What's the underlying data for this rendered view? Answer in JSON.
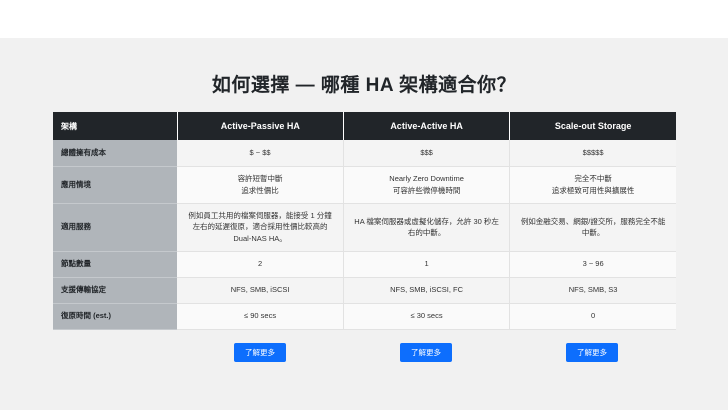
{
  "title": "如何選擇 — 哪種 HA 架構適合你？",
  "table": {
    "corner": "架構",
    "columns": [
      "Active-Passive HA",
      "Active-Active HA",
      "Scale-out Storage"
    ],
    "rows": [
      {
        "label": "總體擁有成本",
        "cells": [
          "$ ~ $$",
          "$$$",
          "$$$$$"
        ]
      },
      {
        "label": "應用情境",
        "cells": [
          "容許短暫中斷\n追求性價比",
          "Nearly Zero Downtime\n可容許些微停機時間",
          "完全不中斷\n追求極致可用性與擴展性"
        ]
      },
      {
        "label": "適用服務",
        "cells": [
          "例如員工共用的檔案伺服器，能接受 1 分鐘左右的延遲復原，適合採用性價比較高的 Dual-NAS HA。",
          "HA 檔案伺服器或虛擬化儲存，允許 30 秒左右的中斷。",
          "例如金融交易、網銀/證交所，服務完全不能中斷。"
        ]
      },
      {
        "label": "節點數量",
        "cells": [
          "2",
          "1",
          "3 ~ 96"
        ]
      },
      {
        "label": "支援傳輸協定",
        "cells": [
          "NFS, SMB, iSCSI",
          "NFS, SMB, iSCSI, FC",
          "NFS, SMB, S3"
        ]
      },
      {
        "label": "復原時間 (est.)",
        "cells": [
          "≤ 90 secs",
          "≤ 30 secs",
          "0"
        ]
      }
    ]
  },
  "buttons": [
    "了解更多",
    "了解更多",
    "了解更多"
  ]
}
